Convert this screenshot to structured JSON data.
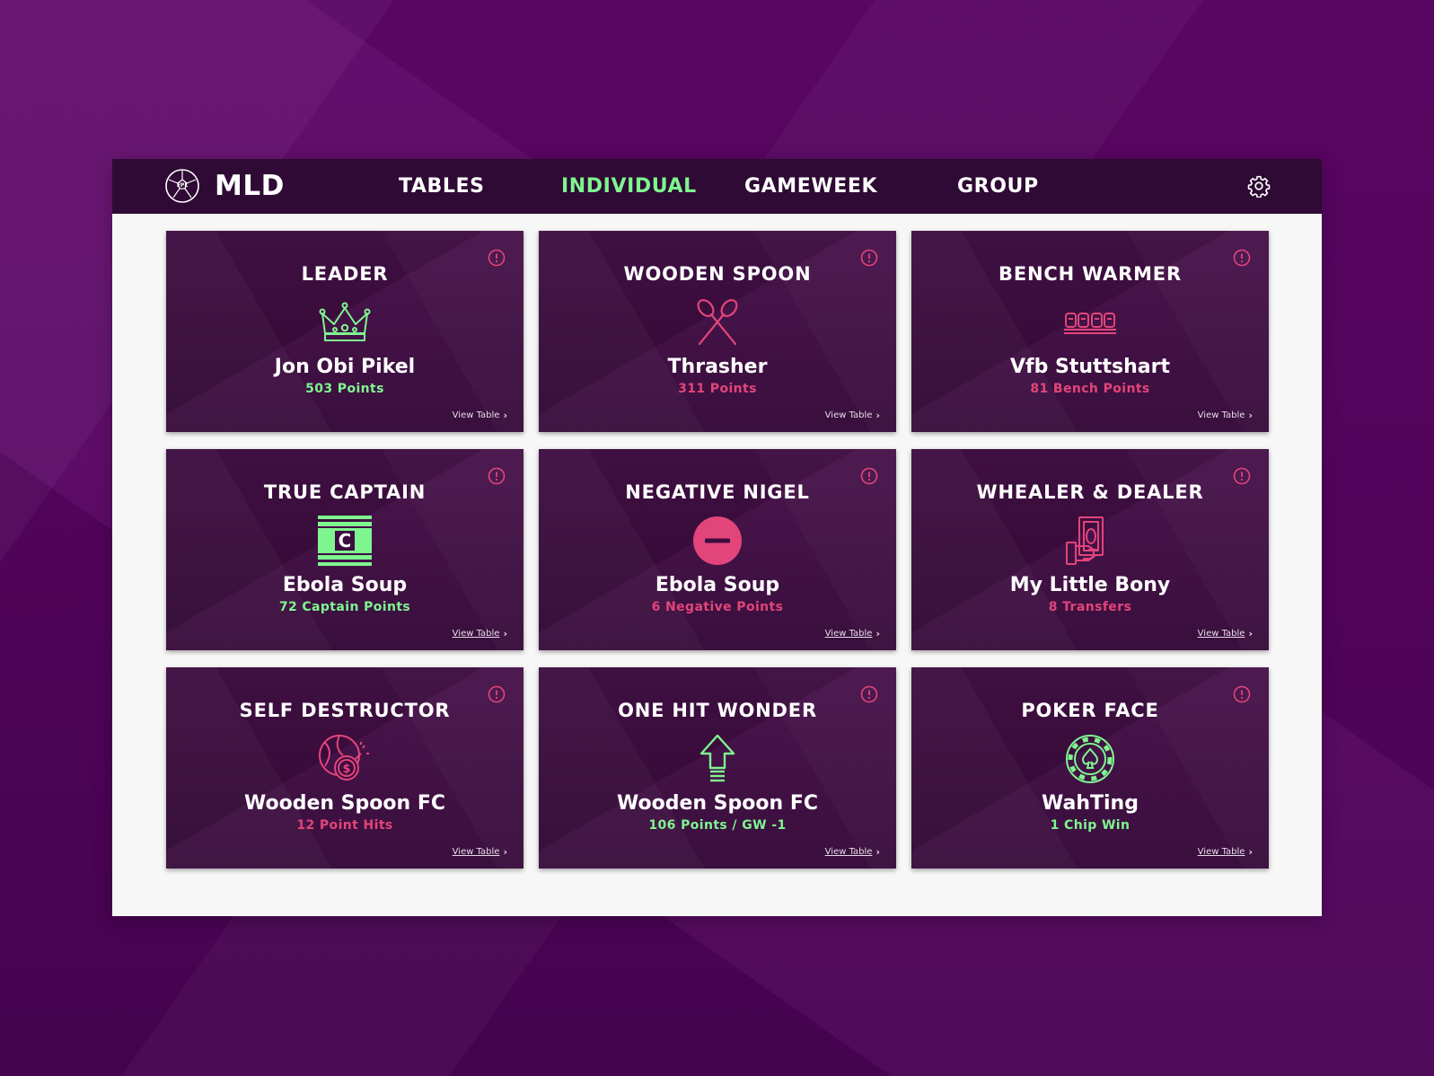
{
  "app": {
    "name": "MLD",
    "logo_icon": "fpl-ball-icon"
  },
  "nav": {
    "items": [
      {
        "label": "TABLES",
        "active": false
      },
      {
        "label": "INDIVIDUAL",
        "active": true
      },
      {
        "label": "GAMEWEEK",
        "active": false
      },
      {
        "label": "GROUP",
        "active": false
      }
    ],
    "settings_icon": "gear-icon"
  },
  "colors": {
    "accent_green": "#7ff58f",
    "accent_pink": "#e2457a",
    "navbar": "#2e0a34",
    "card": "#3d0c40"
  },
  "cards": [
    {
      "title": "LEADER",
      "icon": "crown-icon",
      "winner": "Jon Obi Pikel",
      "stat": "503 Points",
      "stat_color": "green",
      "link": "View Table"
    },
    {
      "title": "WOODEN SPOON",
      "icon": "crossed-spoons-icon",
      "winner": "Thrasher",
      "stat": "311 Points",
      "stat_color": "pink",
      "link": "View Table"
    },
    {
      "title": "BENCH WARMER",
      "icon": "bench-seats-icon",
      "winner": "Vfb Stuttshart",
      "stat": "81 Bench Points",
      "stat_color": "pink",
      "link": "View Table"
    },
    {
      "title": "TRUE CAPTAIN",
      "icon": "captain-armband-icon",
      "winner": "Ebola Soup",
      "stat": "72 Captain Points",
      "stat_color": "green",
      "link": "View Table"
    },
    {
      "title": "NEGATIVE NIGEL",
      "icon": "minus-circle-icon",
      "winner": "Ebola Soup",
      "stat": "6 Negative Points",
      "stat_color": "pink",
      "link": "View Table"
    },
    {
      "title": "WHEALER & DEALER",
      "icon": "cash-in-hand-icon",
      "winner": "My Little Bony",
      "stat": "8 Transfers",
      "stat_color": "pink",
      "link": "View Table"
    },
    {
      "title": "SELF DESTRUCTOR",
      "icon": "ball-money-bomb-icon",
      "winner": "Wooden Spoon FC",
      "stat": "12 Point Hits",
      "stat_color": "pink",
      "link": "View Table"
    },
    {
      "title": "ONE HIT WONDER",
      "icon": "up-arrow-icon",
      "winner": "Wooden Spoon FC",
      "stat": "106 Points / GW -1",
      "stat_color": "green",
      "link": "View Table"
    },
    {
      "title": "POKER FACE",
      "icon": "poker-chip-icon",
      "winner": "WahTing",
      "stat": "1 Chip Win",
      "stat_color": "green",
      "link": "View Table"
    }
  ]
}
